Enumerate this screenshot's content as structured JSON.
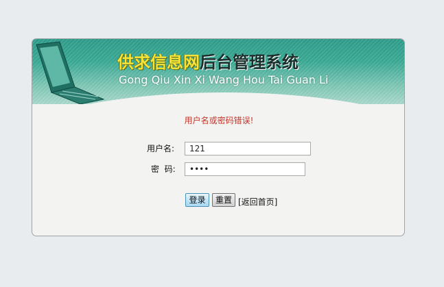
{
  "banner": {
    "title_highlight": "供求信息网",
    "title_rest": "后台管理系统",
    "subtitle": "Gong Qiu Xin Xi Wang Hou Tai Guan Li"
  },
  "login": {
    "error_message": "用户名或密码错误!",
    "username_label": "用户名:",
    "username_value": "121",
    "password_label": "密  码:",
    "password_value": "1234",
    "login_button": "登录",
    "reset_button": "重置",
    "home_link": "[返回首页]"
  },
  "colors": {
    "banner_teal": "#3aaa95",
    "title_yellow": "#f7e43a",
    "error_red": "#c0352b",
    "page_background": "#e8ecef"
  }
}
